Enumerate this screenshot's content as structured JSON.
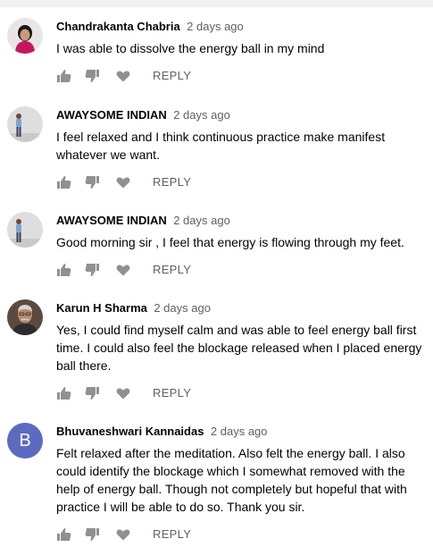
{
  "comments": [
    {
      "author": "Chandrakanta Chabria",
      "time": "2 days ago",
      "text": "I was able to dissolve the energy ball in my mind",
      "reply_label": "REPLY",
      "avatar": "photo"
    },
    {
      "author": "AWAYSOME INDIAN",
      "time": "2 days ago",
      "text": "I feel relaxed and I think continuous practice make manifest whatever we want.",
      "reply_label": "REPLY",
      "avatar": "photo"
    },
    {
      "author": "AWAYSOME INDIAN",
      "time": "2 days ago",
      "text": "Good morning sir , I feel that energy is flowing through my feet.",
      "reply_label": "REPLY",
      "avatar": "photo"
    },
    {
      "author": "Karun H Sharma",
      "time": "2 days ago",
      "text": "Yes,  I could find myself calm and was able to feel energy ball first time. I could also feel the blockage released when I placed energy ball there.",
      "reply_label": "REPLY",
      "avatar": "photo"
    },
    {
      "author": "Bhuvaneshwari Kannaidas",
      "time": "2 days ago",
      "text": "Felt relaxed after the meditation. Also felt the energy ball. I also could identify the blockage which I somewhat removed with the help of energy ball. Though not completely but hopeful that with practice I will be able to do so. Thank you sir.",
      "reply_label": "REPLY",
      "avatar": "letter",
      "avatar_letter": "B",
      "avatar_color": "#5c6bc0"
    }
  ],
  "icons": {
    "like": "thumbs-up-icon",
    "dislike": "thumbs-down-icon",
    "heart": "heart-icon"
  },
  "colors": {
    "author": "#030303",
    "meta": "#606060",
    "icon": "#909090"
  }
}
